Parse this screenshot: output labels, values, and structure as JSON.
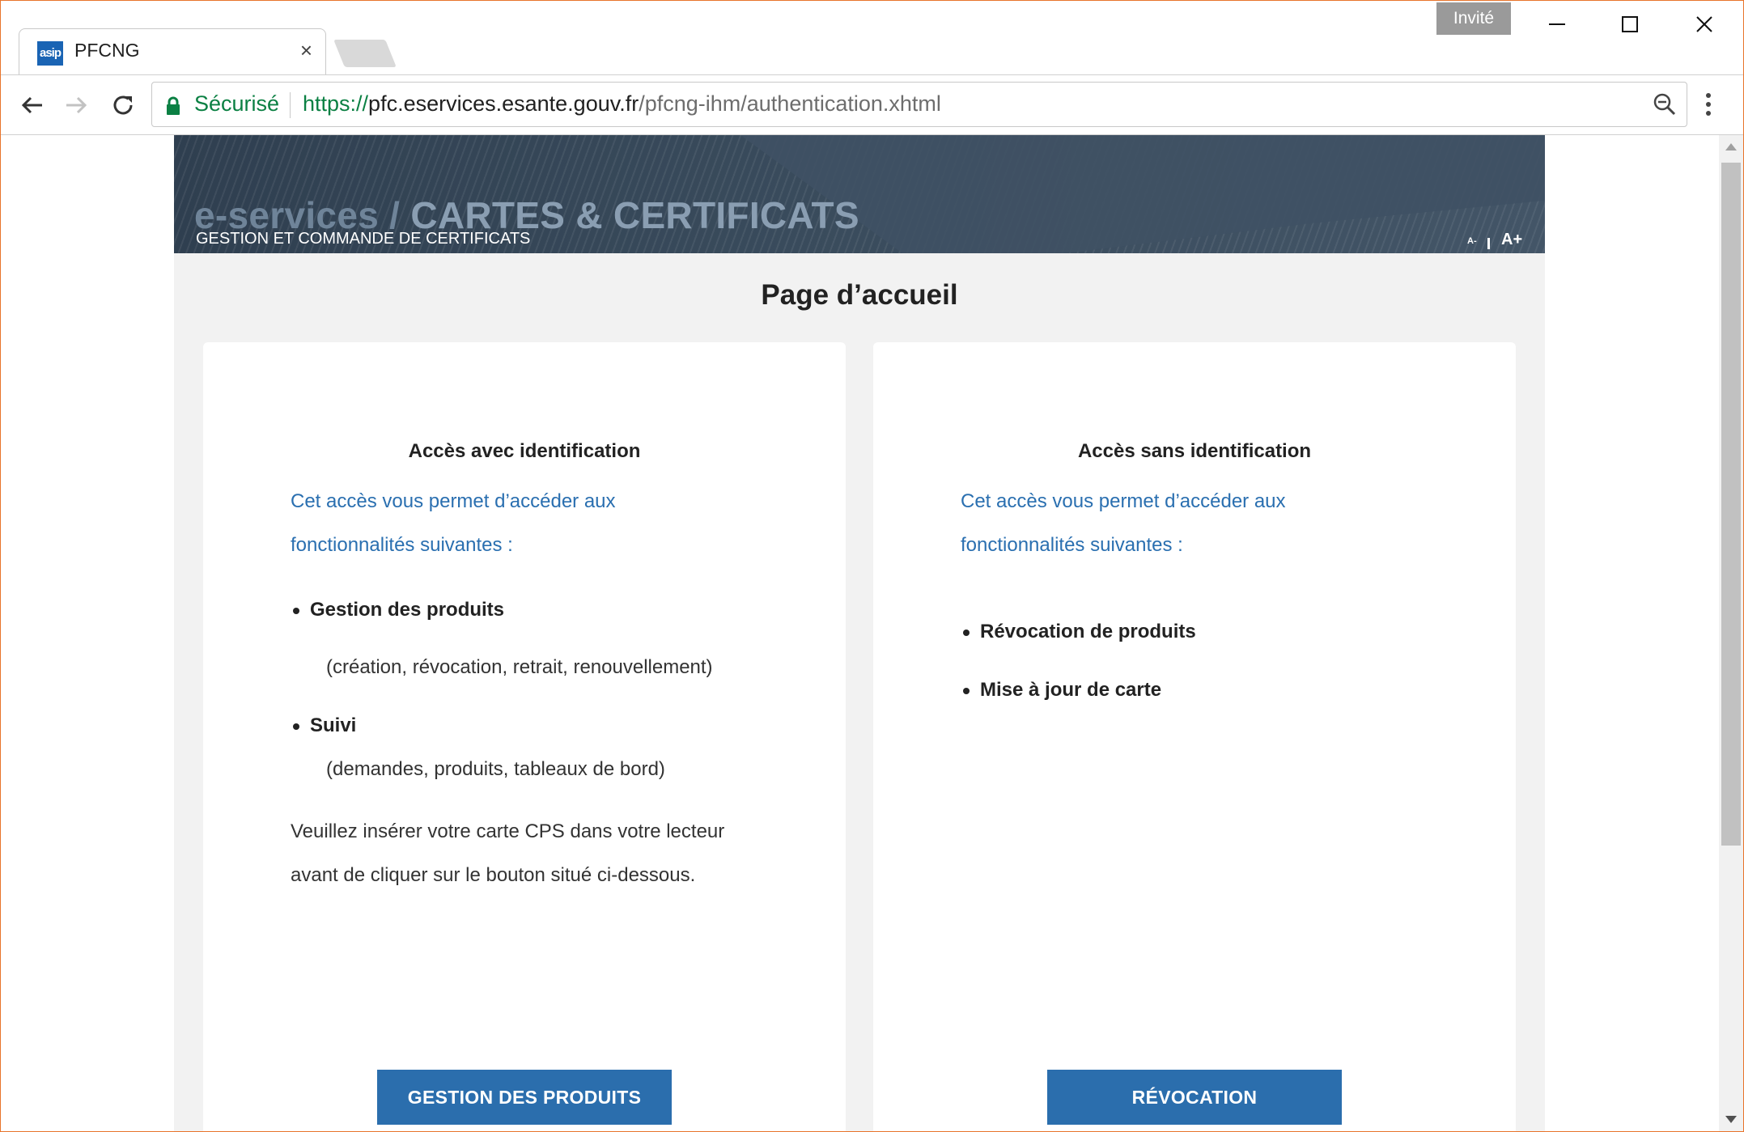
{
  "browser": {
    "tab_title": "PFCNG",
    "favicon_text": "asip",
    "close_tab_glyph": "×",
    "guest_label": "Invité",
    "secure_label": "Sécurisé",
    "url": {
      "protocol": "https://",
      "host": "pfc.eservices.esante.gouv.fr",
      "path": "/pfcng-ihm/authentication.xhtml"
    },
    "icons": [
      "back-arrow-icon",
      "forward-arrow-icon",
      "reload-icon",
      "lock-icon",
      "zoom-icon",
      "menu-dots-icon",
      "minimize-icon",
      "maximize-icon",
      "close-icon"
    ],
    "colors": {
      "secure": "#0b8043",
      "window_border": "#e8742b"
    }
  },
  "banner": {
    "title_part1": "e-services / ",
    "title_part2": "CARTES & CERTIFICATS",
    "subtitle": "GESTION ET COMMANDE DE CERTIFICATS",
    "font_decrease": "A-",
    "font_increase": "A+"
  },
  "page": {
    "title": "Page d’accueil"
  },
  "cards": {
    "with_id": {
      "title": "Accès avec identification",
      "intro_line1": "Cet accès vous permet d’accéder aux",
      "intro_line2": "fonctionnalités suivantes :",
      "items": [
        {
          "label": "Gestion des produits",
          "detail": "(création, révocation, retrait, renouvellement)"
        },
        {
          "label": "Suivi",
          "detail": "(demandes, produits, tableaux de bord)"
        }
      ],
      "note_line1": "Veuillez insérer votre carte CPS dans votre lecteur",
      "note_line2": "avant de cliquer sur le bouton situé ci-dessous.",
      "button": "GESTION DES PRODUITS"
    },
    "without_id": {
      "title": "Accès sans identification",
      "intro_line1": "Cet accès vous permet d’accéder aux",
      "intro_line2": "fonctionnalités suivantes :",
      "items": [
        {
          "label": "Révocation de produits"
        },
        {
          "label": "Mise à jour de carte"
        }
      ],
      "button": "RÉVOCATION"
    }
  },
  "colors": {
    "accent": "#2b6ead",
    "link_text": "#2a6fb0",
    "banner_dark": "#2f3f50"
  }
}
